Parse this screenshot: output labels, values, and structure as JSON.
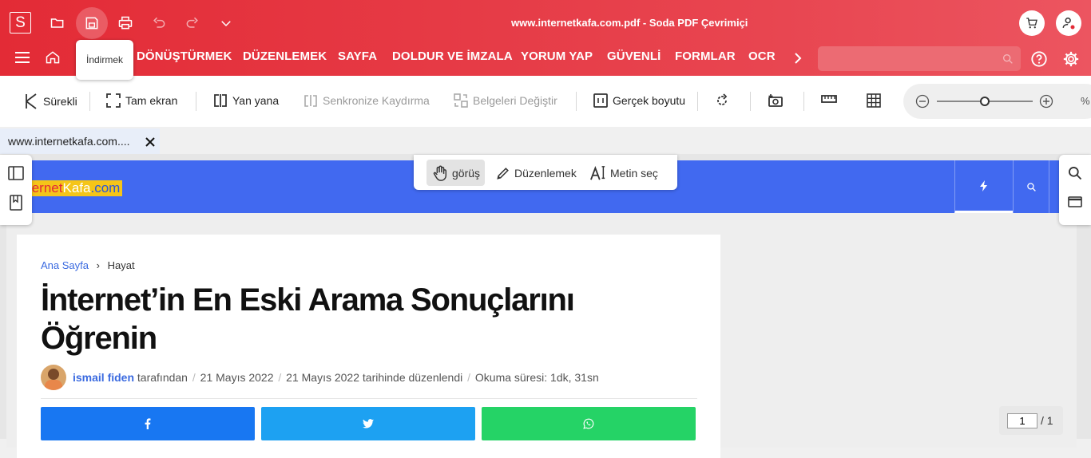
{
  "app": {
    "logo_letter": "S",
    "doc_title": "www.internetkafa.com.pdf - Soda PDF Çevrimiçi",
    "tooltip": "İndirmek"
  },
  "menu": {
    "items": [
      "DÖNÜŞTÜRMEK",
      "DÜZENLEMEK",
      "SAYFA",
      "DOLDUR VE İMZALA",
      "YORUM YAP",
      "GÜVENLİ",
      "FORMLAR",
      "OCR"
    ],
    "search_placeholder": ""
  },
  "toolbar": {
    "continuous": "Sürekli",
    "fullscreen": "Tam ekran",
    "side_by_side": "Yan yana",
    "sync_scroll": "Senkronize Kaydırma",
    "swap_docs": "Belgeleri Değiştir",
    "actual_size": "Gerçek boyutu",
    "zoom_pct_symbol": "%"
  },
  "tab": {
    "label": "www.internetkafa.com...."
  },
  "modes": {
    "view": "görüş",
    "edit": "Düzenlemek",
    "select_text": "Metin seç"
  },
  "article": {
    "site_logo_a": "ternet",
    "site_logo_b": "Kafa",
    "site_logo_c": ".com",
    "breadcrumb_home": "Ana Sayfa",
    "breadcrumb_sep": "›",
    "breadcrumb_cat": "Hayat",
    "title": "İnternet’in En Eski Arama Sonuçlarını Öğrenin",
    "author": "ismail fiden",
    "meta_by": "tarafından",
    "meta_sep": "/",
    "date": "21 Mayıs 2022",
    "edited": "21 Mayıs 2022 tarihinde düzenlendi",
    "read_time": "Okuma süresi: 1dk, 31sn",
    "share_colors": [
      "#1877f2",
      "#1da1f2",
      "#25d366"
    ]
  },
  "pager": {
    "current": "1",
    "total": "/ 1"
  }
}
